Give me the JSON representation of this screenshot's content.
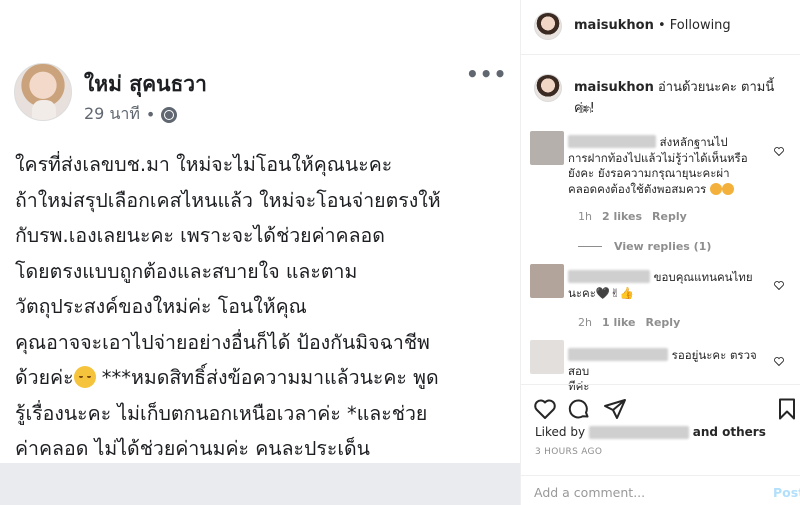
{
  "facebook_post": {
    "author": "ใหม่ สุคนธวา",
    "time": "29 นาที",
    "separator": "•",
    "more_label": "•••",
    "body_lines": [
      "ใครที่ส่งเลขบช.มา ใหม่จะไม่โอนให้คุณนะคะ",
      "ถ้าใหม่สรุปเลือกเคสไหนแล้ว ใหม่จะโอนจ่ายตรงให้",
      "กับรพ.เองเลยนะคะ เพราะจะได้ช่วยค่าคลอด",
      "โดยตรงแบบถูกต้องและสบายใจ และตาม",
      "วัตถุประสงค์ของใหม่ค่ะ โอนให้คุณ",
      "คุณอาจจะเอาไปจ่ายอย่างอื่นก็ได้ ป้องกันมิจฉาชีพ",
      "ด้วยค่ะ",
      " ***หมดสิทธิ์ส่งข้อความมาแล้วนะคะ พูด",
      "รู้เรื่องนะคะ ไม่เก็บตกนอกเหนือเวลาค่ะ *และช่วย",
      "ค่าคลอด ไม่ได้ช่วยค่านมค่ะ คนละประเด็น"
    ],
    "icons": {
      "globe": "globe-icon",
      "emoji": "relieved-face-emoji"
    }
  },
  "instagram": {
    "header": {
      "username": "maisukhon",
      "separator": " • ",
      "follow_status": "Following"
    },
    "caption": {
      "username": "maisukhon",
      "text": " อ่านด้วยนะคะ ตามนี้ค่ะ!",
      "time": "3h"
    },
    "comments": [
      {
        "text_line1": " ส่งหลักฐานไป",
        "text_line2": "การฝากท้องไปแล้วไม่รู้ว่าได้เห็นหรือ",
        "text_line3": "ยังคะ ยังรอความกรุณายุนะคะผ่า",
        "text_line4": "คลอดคงต้องใช้ตังพอสมควร",
        "time": "1h",
        "likes": "2 likes",
        "reply": "Reply",
        "view_replies": "View replies (1)"
      },
      {
        "text_line1": " ขอบคุณแทนคนไทย",
        "text_line2": "นะคะ",
        "emoji_text": "🖤✌👍",
        "time": "2h",
        "likes": "1 like",
        "reply": "Reply"
      },
      {
        "text_line1": " รออยู่นะคะ ตรวจสอบ",
        "text_line2": "ทีค่ะ"
      }
    ],
    "liked_by_prefix": "Liked by",
    "liked_by_suffix": "and others",
    "date": "3 HOURS AGO",
    "add_comment_placeholder": "Add a comment...",
    "post_button": "Post",
    "colors": {
      "post_disabled": "#b2dffc",
      "muted": "#8e8e8e",
      "fb_bottom": "#e9ebee"
    }
  }
}
